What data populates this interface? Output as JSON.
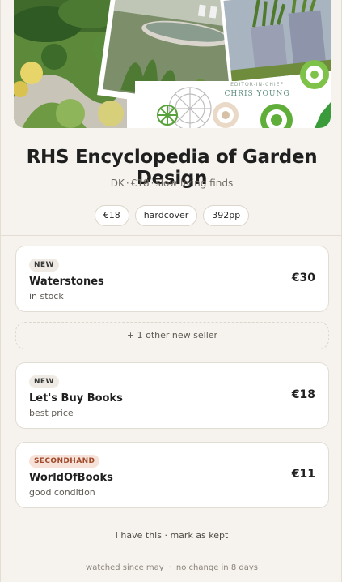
{
  "book": {
    "cover_editor_label": "EDITOR-IN-CHIEF",
    "cover_editor_name": "CHRIS YOUNG",
    "title": "RHS Encyclopedia of Garden Design",
    "publisher": "DK",
    "price": "€18",
    "tagline": "slow living finds",
    "separator": "·"
  },
  "chips": [
    "€18",
    "hardcover",
    "392pp"
  ],
  "sellers": [
    {
      "badge": "NEW",
      "name": "Waterstones",
      "note": "in stock",
      "price": "€30"
    },
    {
      "badge": "NEW",
      "name": "Let's Buy Books",
      "note": "best price",
      "price": "€18"
    },
    {
      "badge": "SECONDHAND",
      "name": "WorldOfBooks",
      "note": "good condition",
      "price": "€11"
    }
  ],
  "more_sellers": "+ 1 other new seller",
  "action": {
    "text": "I have this · mark as kept"
  },
  "footer": {
    "watched": "watched since may",
    "dot": "·",
    "change": "no change in 8 days"
  },
  "colors": {
    "background": "#f6f3ee",
    "card": "#ffffff",
    "secondhand_badge": "#f6e2d8",
    "secondhand_text": "#a04a2a"
  }
}
